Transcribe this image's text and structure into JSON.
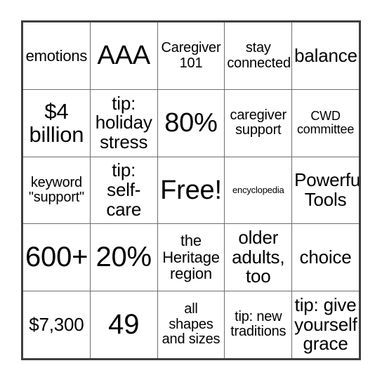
{
  "card": {
    "type": "bingo-card",
    "rows": 5,
    "columns": 5,
    "free_space": "Free!",
    "free_space_position": {
      "row": 3,
      "column": 3
    },
    "colors": {
      "background": "#ffffff",
      "text": "#000000",
      "outer_border": "#3f3f3f",
      "grid_line": "#6e6e6e"
    },
    "cells": [
      {
        "id": "r1c1",
        "text": "emotions",
        "size": "sm"
      },
      {
        "id": "r1c2",
        "text": "AAA",
        "size": "xl"
      },
      {
        "id": "r1c3",
        "text": "Caregiver\n101",
        "size": "xs"
      },
      {
        "id": "r1c4",
        "text": "stay\nconnected",
        "size": "xs"
      },
      {
        "id": "r1c5",
        "text": "balance",
        "size": "md"
      },
      {
        "id": "r2c1",
        "text": "$4\nbillion",
        "size": "lg"
      },
      {
        "id": "r2c2",
        "text": "tip:\nholiday\nstress",
        "size": "md"
      },
      {
        "id": "r2c3",
        "text": "80%",
        "size": "xl"
      },
      {
        "id": "r2c4",
        "text": "caregiver\nsupport",
        "size": "xs"
      },
      {
        "id": "r2c5",
        "text": "CWD\ncommittee",
        "size": "xxs"
      },
      {
        "id": "r3c1",
        "text": "keyword\n\"support\"",
        "size": "xs"
      },
      {
        "id": "r3c2",
        "text": "tip:\nself-\ncare",
        "size": "md"
      },
      {
        "id": "r3c3",
        "text": "Free!",
        "size": "xl"
      },
      {
        "id": "r3c4",
        "text": "encyclopedia",
        "size": "tiny"
      },
      {
        "id": "r3c5",
        "text": "Powerful\nTools",
        "size": "md"
      },
      {
        "id": "r4c1",
        "text": "600+",
        "size": "xxl"
      },
      {
        "id": "r4c2",
        "text": "20%",
        "size": "xxl"
      },
      {
        "id": "r4c3",
        "text": "the\nHeritage\nregion",
        "size": "sm"
      },
      {
        "id": "r4c4",
        "text": "older\nadults,\ntoo",
        "size": "md"
      },
      {
        "id": "r4c5",
        "text": "choice",
        "size": "md"
      },
      {
        "id": "r5c1",
        "text": "$7,300",
        "size": "md"
      },
      {
        "id": "r5c2",
        "text": "49",
        "size": "xxl"
      },
      {
        "id": "r5c3",
        "text": "all\nshapes\nand sizes",
        "size": "xs"
      },
      {
        "id": "r5c4",
        "text": "tip: new\ntraditions",
        "size": "xs"
      },
      {
        "id": "r5c5",
        "text": "tip: give\nyourself\ngrace",
        "size": "md"
      }
    ]
  }
}
